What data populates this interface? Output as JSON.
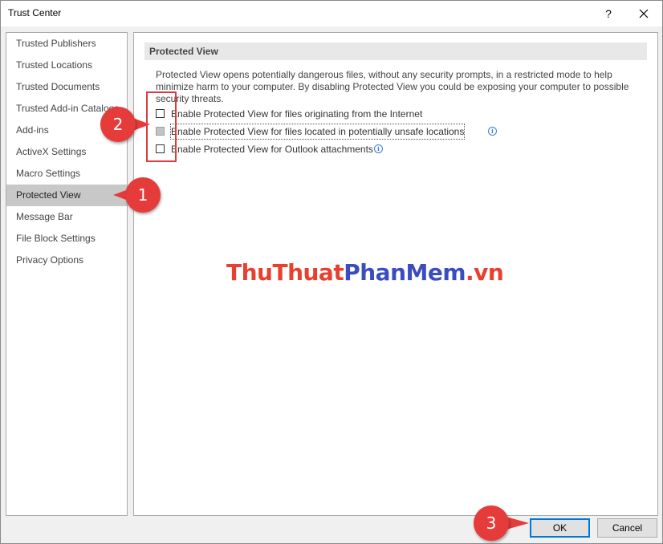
{
  "window": {
    "title": "Trust Center",
    "help_label": "?"
  },
  "nav": {
    "items": [
      {
        "label": "Trusted Publishers"
      },
      {
        "label": "Trusted Locations"
      },
      {
        "label": "Trusted Documents"
      },
      {
        "label": "Trusted Add-in Catalogs"
      },
      {
        "label": "Add-ins"
      },
      {
        "label": "ActiveX Settings"
      },
      {
        "label": "Macro Settings"
      },
      {
        "label": "Protected View",
        "selected": true
      },
      {
        "label": "Message Bar"
      },
      {
        "label": "File Block Settings"
      },
      {
        "label": "Privacy Options"
      }
    ]
  },
  "content": {
    "header": "Protected View",
    "description": "Protected View opens potentially dangerous files, without any security prompts, in a restricted mode to help minimize harm to your computer. By disabling Protected View you could be exposing your computer to possible security threats.",
    "options": [
      {
        "label": "Enable Protected View for files originating from the Internet",
        "checked": false,
        "grayed": false,
        "info": false
      },
      {
        "label": "Enable Protected View for files located in potentially unsafe locations",
        "checked": false,
        "grayed": true,
        "info": true
      },
      {
        "label": "Enable Protected View for Outlook attachments",
        "checked": false,
        "grayed": false,
        "info": true
      }
    ],
    "info_glyph": "i"
  },
  "annotations": {
    "markers": [
      "1",
      "2",
      "3"
    ],
    "color": "#e53b3b"
  },
  "watermark": {
    "part1": "ThuThuat",
    "part2": "PhanMem",
    "part3": ".vn"
  },
  "buttons": {
    "ok": "OK",
    "cancel": "Cancel"
  },
  "icons": {
    "close": "close-icon",
    "info": "info-icon"
  }
}
